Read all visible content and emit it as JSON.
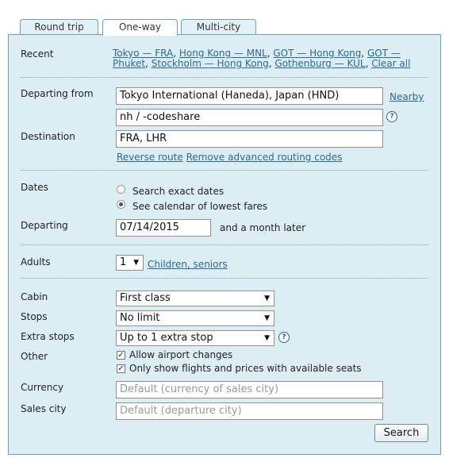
{
  "tabs": [
    "Round trip",
    "One-way",
    "Multi-city"
  ],
  "recent": {
    "label": "Recent",
    "line1": [
      "Tokyo — FRA",
      "Hong Kong — MNL",
      "GOT — Hong Kong",
      "GOT —"
    ],
    "line2": [
      "Phuket",
      "Stockholm — Hong Kong",
      "Gothenburg — KUL",
      "Clear all"
    ]
  },
  "departing_from": {
    "label": "Departing from",
    "value": "Tokyo International (Haneda), Japan (HND)",
    "nearby": "Nearby",
    "routing_value": "nh / -codeshare",
    "help": "?"
  },
  "destination": {
    "label": "Destination",
    "value": "FRA, LHR",
    "reverse_route": "Reverse route",
    "remove_codes": "Remove advanced routing codes"
  },
  "dates": {
    "label": "Dates",
    "option_exact": "Search exact dates",
    "option_calendar": "See calendar of lowest fares",
    "selected": "See calendar of lowest fares"
  },
  "departing": {
    "label": "Departing",
    "value": "07/14/2015",
    "suffix": "and a month later"
  },
  "adults": {
    "label": "Adults",
    "value": "1",
    "link": "Children, seniors"
  },
  "cabin": {
    "label": "Cabin",
    "value": "First class"
  },
  "stops": {
    "label": "Stops",
    "value": "No limit"
  },
  "extra_stops": {
    "label": "Extra stops",
    "value": "Up to 1 extra stop",
    "help": "?"
  },
  "other": {
    "label": "Other",
    "allow_airport_changes": "Allow airport changes",
    "only_available": "Only show flights and prices with available seats",
    "allow_checked": true,
    "only_checked": true
  },
  "currency": {
    "label": "Currency",
    "placeholder": "Default (currency of sales city)"
  },
  "sales_city": {
    "label": "Sales city",
    "placeholder": "Default (departure city)"
  },
  "search_button": "Search",
  "colors": {
    "panel_bg": "#dcedf4",
    "border": "#6aa3b8",
    "link": "#2a6a9a"
  }
}
